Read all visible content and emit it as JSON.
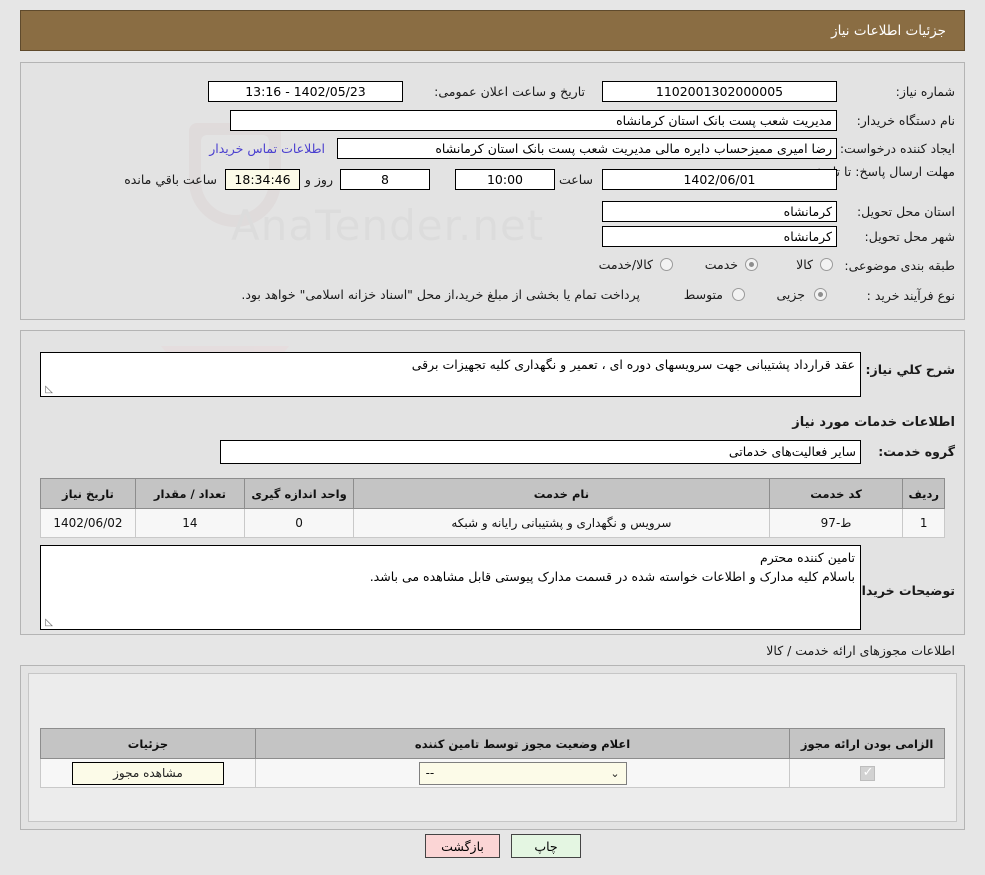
{
  "header": {
    "title": "جزئیات اطلاعات نیاز"
  },
  "form": {
    "need_number_label": "شماره نیاز:",
    "need_number_value": "1102001302000005",
    "announce_label": "تاریخ و ساعت اعلان عمومی:",
    "announce_value": "1402/05/23 - 13:16",
    "buyer_org_label": "نام دستگاه خریدار:",
    "buyer_org_value": "مدیریت شعب پست بانک استان کرمانشاه",
    "creator_label": "ایجاد کننده درخواست:",
    "creator_value": "رضا امیری ممیزحساب دایره مالی مدیریت شعب پست بانک استان کرمانشاه",
    "contact_link": "اطلاعات تماس خریدار",
    "deadline_label": "مهلت ارسال پاسخ: تا تاریخ:",
    "deadline_date": "1402/06/01",
    "hour_label": "ساعت",
    "deadline_time": "10:00",
    "days_remaining": "8",
    "days_word": "روز و",
    "countdown": "18:34:46",
    "hours_remaining_label": "ساعت باقي مانده",
    "province_label": "استان محل تحویل:",
    "province_value": "کرمانشاه",
    "city_label": "شهر محل تحویل:",
    "city_value": "کرمانشاه",
    "category_label": "طبقه بندی موضوعی:",
    "category_options": [
      "کالا",
      "خدمت",
      "کالا/خدمت"
    ],
    "category_selected": "خدمت",
    "process_label": "نوع فرآیند خرید :",
    "process_options": [
      "جزیی",
      "متوسط"
    ],
    "process_selected": "جزیی",
    "payment_note": "پرداخت تمام یا بخشی از مبلغ خرید،از محل \"اسناد خزانه اسلامی\" خواهد بود."
  },
  "need_desc": {
    "label": "شرح کلي نياز:",
    "value": "عقد قرارداد پشتیبانی جهت سرویسهای دوره ای ، تعمیر و نگهداری کلیه تجهیزات برقی"
  },
  "services_section": {
    "heading": "اطلاعات خدمات مورد نیاز",
    "group_label": "گروه خدمت:",
    "group_value": "سایر فعالیت‌های خدماتی",
    "columns": [
      "ردیف",
      "کد خدمت",
      "نام خدمت",
      "واحد اندازه گیری",
      "تعداد / مقدار",
      "تاریخ نیاز"
    ],
    "rows": [
      {
        "row": "1",
        "code": "ط-97",
        "name": "سرویس و نگهداری و پشتیبانی رایانه و شبکه",
        "unit": "0",
        "quantity": "14",
        "date": "1402/06/02"
      }
    ]
  },
  "buyer_notes": {
    "label": "توضیحات خریدار:",
    "line1": "تامین کننده محترم",
    "line2": "باسلام کلیه مدارک و اطلاعات خواسته شده در قسمت مدارک پیوستی قابل مشاهده می باشد."
  },
  "permits": {
    "heading": "اطلاعات مجوزهای ارائه خدمت / کالا",
    "columns": [
      "الزامی بودن ارائه مجوز",
      "اعلام وضعیت مجوز توسط تامین کننده",
      "جزئیات"
    ],
    "rows": [
      {
        "required": true,
        "status_value": "--",
        "details_button": "مشاهده مجوز"
      }
    ]
  },
  "footer": {
    "print_label": "چاپ",
    "back_label": "بازگشت"
  },
  "icons": {
    "chevron_down": "⌄",
    "resize_grip": "◺"
  },
  "colors": {
    "header_bg": "#8a6d43",
    "link": "#4a3fcf",
    "print_btn": "#e4f6e2",
    "back_btn": "#fbd5d5",
    "cream_field": "#fcfbe8"
  }
}
